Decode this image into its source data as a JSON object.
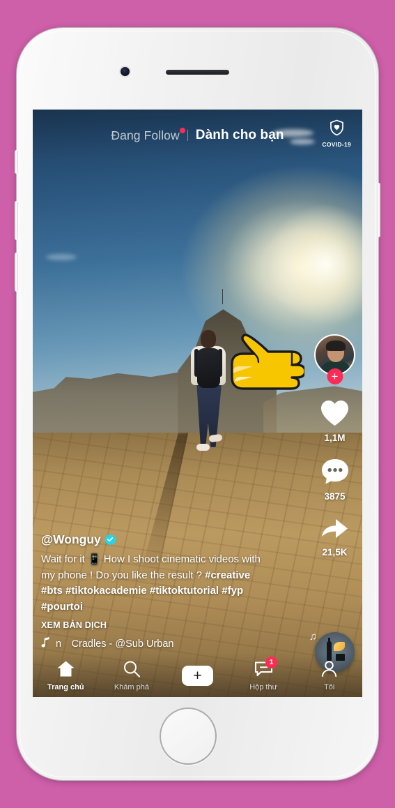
{
  "device": {
    "name": "iphone-white",
    "body_color": "#f4f4f4",
    "background_color": "#ce5fa9"
  },
  "app": {
    "name": "TikTok",
    "locale": "vi"
  },
  "top_nav": {
    "following_tab": "Đang Follow",
    "foryou_tab": "Dành cho bạn",
    "active_tab": "Dành cho bạn",
    "has_following_dot": true,
    "covid_label": "COVID-19",
    "covid_icon": "shield-heart-icon"
  },
  "video": {
    "author_handle": "@Wonguy",
    "verified": true,
    "caption": "Wait for it 📱 How I shoot cinematic videos with my phone ! Do you like the result ?",
    "hashtags": [
      "#creative",
      "#bts",
      "#tiktokacademie",
      "#tiktoktutorial",
      "#fyp",
      "#pourtoi"
    ],
    "translate_label": "XEM BẢN DỊCH",
    "music_title": "Cradles - @Sub Urban",
    "music_marquee_prefix": "n",
    "music_note_icon": "music-note-icon"
  },
  "actions": {
    "avatar_name": "author-avatar",
    "follow_icon": "plus-icon",
    "like": {
      "icon": "heart-icon",
      "count": "1,1M"
    },
    "comment": {
      "icon": "comment-bubble-icon",
      "count": "3875"
    },
    "share": {
      "icon": "share-arrow-icon",
      "count": "21,5K"
    }
  },
  "bottom_nav": {
    "items": [
      {
        "label": "Trang chủ",
        "icon": "home-icon",
        "active": true
      },
      {
        "label": "Khám phá",
        "icon": "search-icon",
        "active": false
      },
      {
        "label": "",
        "icon": "create-plus-icon",
        "active": false
      },
      {
        "label": "Hộp thư",
        "icon": "inbox-message-icon",
        "active": false,
        "badge": "1"
      },
      {
        "label": "Tôi",
        "icon": "profile-person-icon",
        "active": false
      }
    ]
  },
  "overlay": {
    "cursor_icon": "pointing-hand-right-emoji"
  },
  "colors": {
    "accent_pink": "#fe2c55",
    "accent_cyan": "#20d5ec",
    "verified_blue": "#20d5ec",
    "text_primary": "#ffffff"
  }
}
